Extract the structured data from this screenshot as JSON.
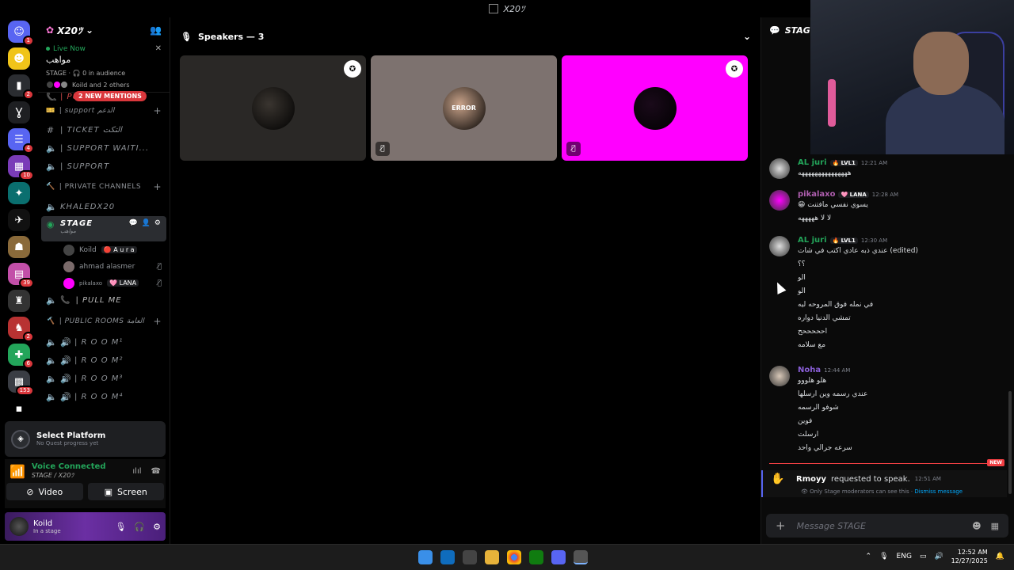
{
  "window": {
    "title": "X20ﾂ"
  },
  "rail": {
    "servers": [
      {
        "badge": "1",
        "color": "#5865f2",
        "glyph": "☺"
      },
      {
        "badge": "",
        "color": "#f0c419",
        "glyph": "☻"
      },
      {
        "badge": "2",
        "color": "#2b2d31",
        "glyph": "▮"
      },
      {
        "badge": "",
        "color": "#1e1f22",
        "glyph": "Ɣ"
      },
      {
        "badge": "4",
        "color": "#5865f2",
        "glyph": "☰"
      },
      {
        "badge": "10",
        "color": "#7a3cb8",
        "glyph": "▦"
      },
      {
        "badge": "",
        "color": "#0a6f6f",
        "glyph": "✦"
      },
      {
        "badge": "",
        "color": "#111",
        "glyph": "✈"
      },
      {
        "badge": "",
        "color": "#8a6a3a",
        "glyph": "☗"
      },
      {
        "badge": "39",
        "color": "#c24fa8",
        "glyph": "▤"
      },
      {
        "badge": "",
        "color": "#333",
        "glyph": "♜"
      },
      {
        "badge": "2",
        "color": "#b83232",
        "glyph": "♞"
      },
      {
        "badge": "6",
        "color": "#23a55a",
        "glyph": "✚"
      },
      {
        "badge": "153",
        "color": "#3a3d44",
        "glyph": "▩"
      },
      {
        "badge": "",
        "color": "#000",
        "glyph": "▪"
      }
    ],
    "new_label": "NEW"
  },
  "sidebar": {
    "server_name": "X20ﾂ",
    "live": {
      "status": "Live Now",
      "name": "مواهب",
      "meta": "STAGE · 🎧 0 in audience",
      "people": "Koild and 2 others"
    },
    "mentions": "2 NEW MENTIONS",
    "pull_me_top": "| PULL ME",
    "support_cat": "| support الدعم",
    "ticket": "| TICKET التكت",
    "support_wait": "| SUPPORT WAITI...",
    "support": "| SUPPORT",
    "private_cat": "| PRIVATE CHANNELS",
    "khaledx": "KHALEDX20",
    "stage": "STAGE",
    "stage_sub": "مواهب",
    "users": [
      {
        "name": "Koild",
        "tag": "🔴 A u r a",
        "color": "#444"
      },
      {
        "name": "ahmad alasmer",
        "tag": "",
        "color": "#7a6a6a"
      },
      {
        "name": "pikalaxo",
        "tag": "🩷 LANA",
        "color": "#ff00ff"
      }
    ],
    "pull_me": "| PULL ME",
    "public_cat": "| PUBLIC ROOMS العامة",
    "rooms": [
      "| R O O M¹",
      "| R O O M²",
      "| R O O M³",
      "| R O O M⁴"
    ]
  },
  "quest": {
    "title": "Select Platform",
    "subtitle": "No Quest progress yet"
  },
  "voice": {
    "status": "Voice Connected",
    "location": "STAGE / X20ﾂ",
    "video_label": "Video",
    "screen_label": "Screen"
  },
  "user": {
    "name": "Koild",
    "status": "In a stage"
  },
  "stage": {
    "speakers_label": "Speakers — 3",
    "tiles": [
      {
        "bg": "#2a2826",
        "avatar": "#3a3530",
        "mod": true,
        "muted": false
      },
      {
        "bg": "#7d726f",
        "avatar": "#c9a38a",
        "mod": false,
        "muted": true,
        "avatar_text": "ERROR"
      },
      {
        "bg": "#ff00ff",
        "avatar": "#1a0a1a",
        "mod": true,
        "muted": true
      }
    ]
  },
  "chat": {
    "channel": "STAGE",
    "messages": [
      {
        "name": "AL juri",
        "name_color": "#23a55a",
        "lvl": "🔥 LVL1",
        "time": "12:21 AM",
        "lines": [
          "هههههههههههههههه"
        ],
        "avatar": "#ddd"
      },
      {
        "name": "pikalaxo",
        "name_color": "#b05fb0",
        "lvl": "🩷 LANA",
        "time": "12:28 AM",
        "lines": [
          "😁 يسوي نفسي مافتنت",
          "لا لا هههههه"
        ],
        "avatar": "#ff00ff"
      },
      {
        "name": "AL juri",
        "name_color": "#23a55a",
        "lvl": "🔥 LVL1",
        "time": "12:30 AM",
        "lines": [
          "عندي ذبه عادي اكتب في شات (edited)",
          "؟؟",
          "الو",
          "الو",
          "في نمله فوق المروحه ليه",
          "تمشي الدنيا دواره",
          "احححححح",
          "مع سلامه"
        ],
        "avatar": "#ddd"
      },
      {
        "name": "Noha",
        "name_color": "#8a5fd8",
        "lvl": "",
        "time": "12:44 AM",
        "lines": [
          "هلو هلووو",
          "عندي رسمه وين ارسلها",
          "شوفو الرسمه",
          "فوين",
          "ارسلت",
          "سرعه جرالي واحد"
        ],
        "avatar": "#d8c8b8"
      }
    ],
    "new_label": "NEW",
    "request": {
      "user": "Rmoyy",
      "text": "requested to speak.",
      "time": "12:51 AM",
      "note": "Only Stage moderators can see this ·",
      "dismiss": "Dismiss message"
    },
    "input_placeholder": "Message STAGE"
  },
  "taskbar": {
    "lang": "ENG",
    "time": "12:52 AM",
    "date": "12/27/2025"
  }
}
